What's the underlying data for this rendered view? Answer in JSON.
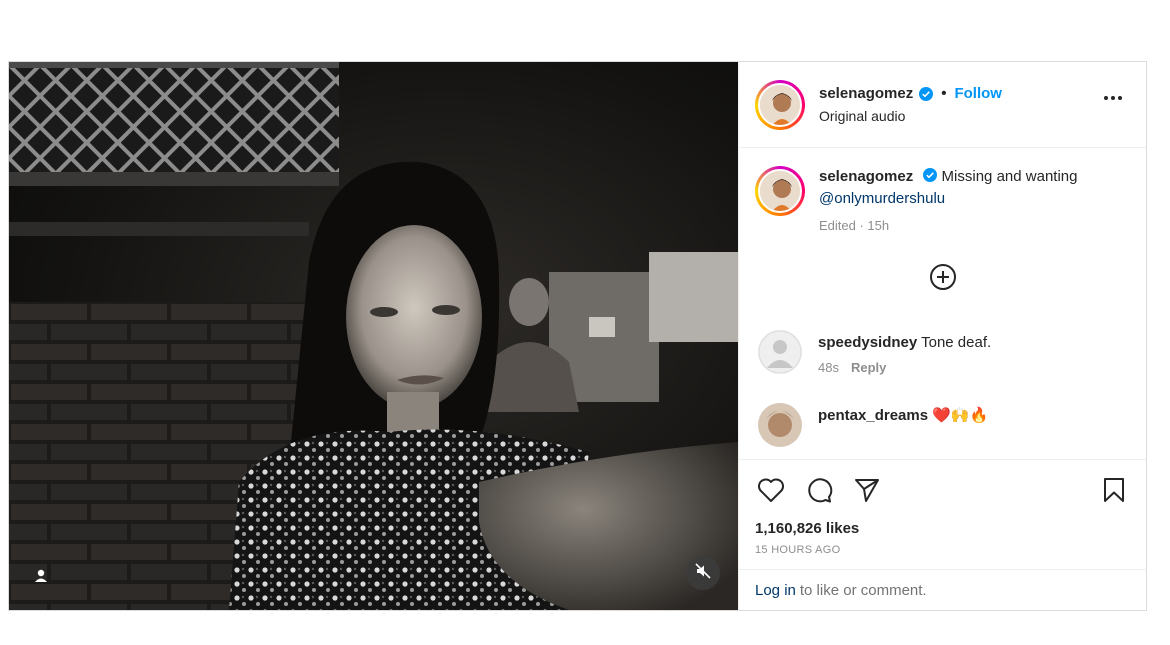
{
  "post": {
    "author": "selenagomez",
    "follow_label": "Follow",
    "separator": "•",
    "audio_label": "Original audio",
    "caption": {
      "username": "selenagomez",
      "text_before": " Missing and wanting ",
      "mention": "@onlymurdershulu",
      "meta": "Edited · 15h"
    },
    "comments": [
      {
        "username": "speedysidney",
        "text": " Tone deaf.",
        "time": "48s",
        "reply_label": "Reply"
      },
      {
        "username": "pentax_dreams",
        "text": " ❤️🙌🔥"
      }
    ],
    "likes": "1,160,826 likes",
    "time_ago": "15 HOURS AGO",
    "login_link": "Log in",
    "login_rest": "to like or comment."
  },
  "icons": {
    "heart": "heart-icon",
    "comment": "comment-bubble-icon",
    "share": "paper-plane-icon",
    "save": "bookmark-icon",
    "verified": "verified-badge-icon",
    "more": "more-options-icon",
    "load_more": "plus-circle-icon",
    "mute": "speaker-muted-icon",
    "tag": "user-tag-icon"
  },
  "colors": {
    "follow": "#0095f6",
    "verified": "#0095f6",
    "mention": "#00376b",
    "meta": "#8e8e8e"
  }
}
